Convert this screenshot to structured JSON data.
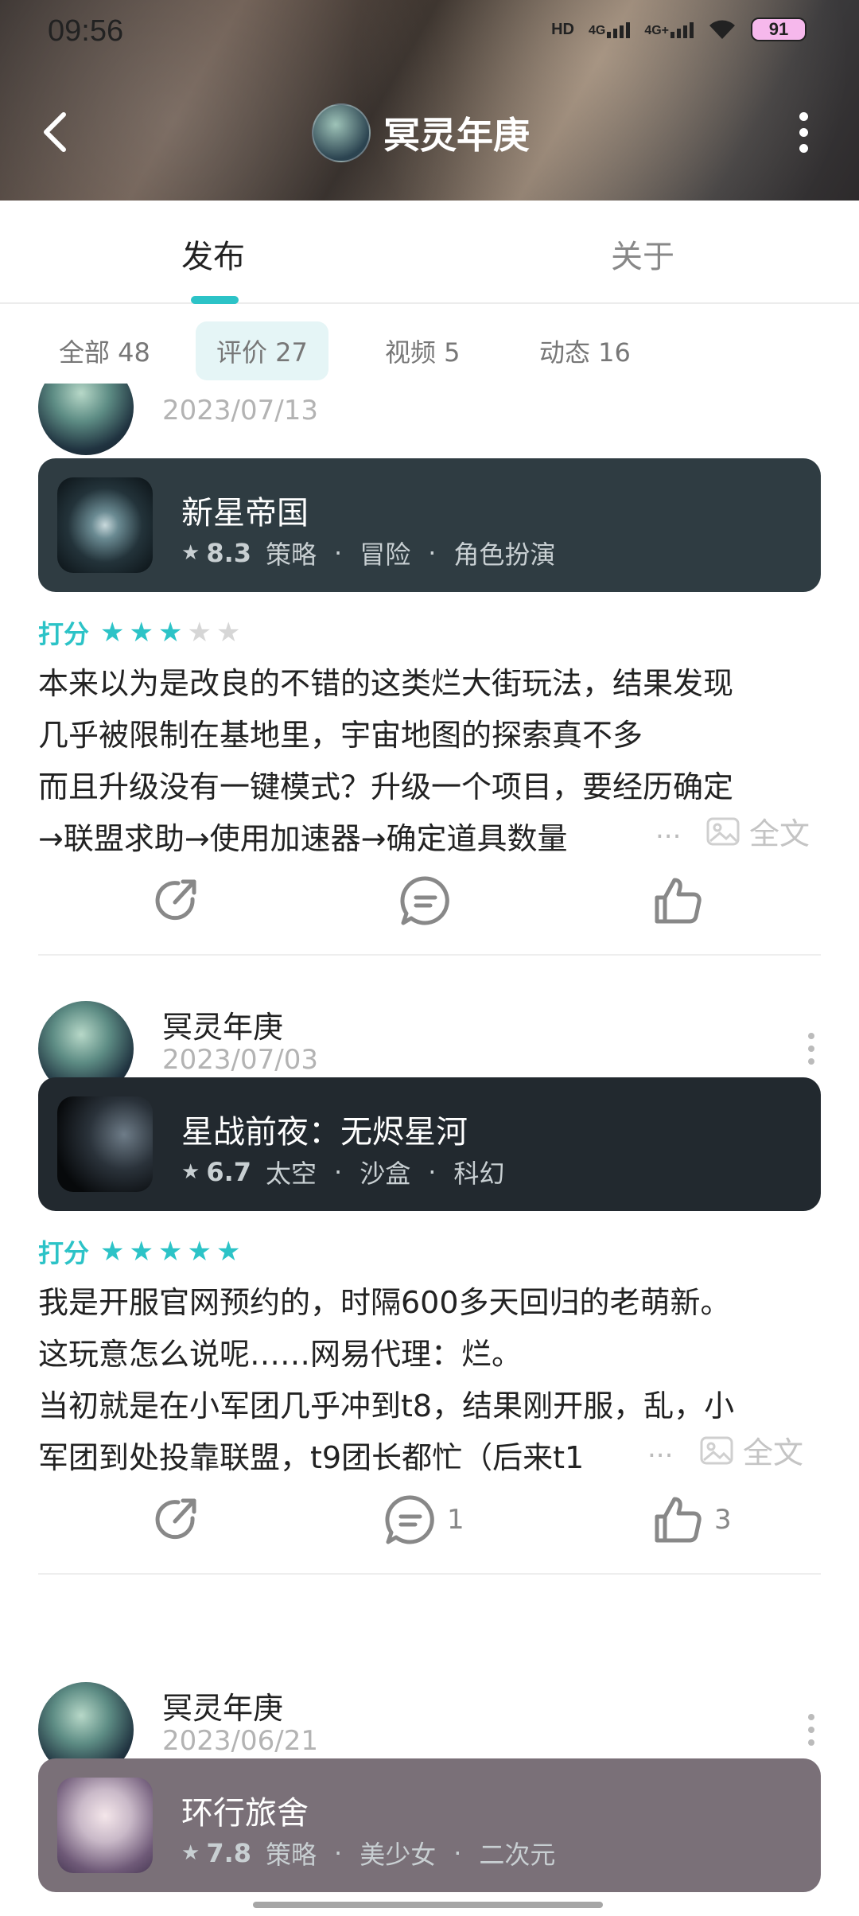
{
  "status_bar": {
    "time": "09:56",
    "battery": "91",
    "hd": "HD",
    "net1": "4G",
    "net2": "4G+"
  },
  "header": {
    "title": "冥灵年庚"
  },
  "tabs": [
    {
      "label": "发布"
    },
    {
      "label": "关于"
    }
  ],
  "filters": [
    {
      "label": "全部 48"
    },
    {
      "label": "评价 27"
    },
    {
      "label": "视频 5"
    },
    {
      "label": "动态 16"
    }
  ],
  "rating_label": "打分",
  "fulltext_label": "全文",
  "ellipsis": "...",
  "posts": [
    {
      "date": "2023/07/13",
      "game": {
        "name": "新星帝国",
        "score": "8.3",
        "tags": [
          "策略",
          "冒险",
          "角色扮演"
        ]
      },
      "stars": 3,
      "lines": [
        "本来以为是改良的不错的这类烂大街玩法，结果发现",
        "几乎被限制在基地里，宇宙地图的探索真不多",
        "而且升级没有一键模式？升级一个项目，要经历确定",
        "→联盟求助→使用加速器→确定道具数量"
      ],
      "comments": "",
      "likes": ""
    },
    {
      "author": "冥灵年庚",
      "date": "2023/07/03",
      "game": {
        "name": "星战前夜：无烬星河",
        "score": "6.7",
        "tags": [
          "太空",
          "沙盒",
          "科幻"
        ]
      },
      "stars": 5,
      "lines": [
        "我是开服官网预约的，时隔600多天回归的老萌新。",
        "这玩意怎么说呢……网易代理：烂。",
        "当初就是在小军团几乎冲到t8，结果刚开服，乱，小",
        "军团到处投靠联盟，t9团长都忙（后来t1"
      ],
      "comments": "1",
      "likes": "3"
    },
    {
      "author": "冥灵年庚",
      "date": "2023/06/21",
      "game": {
        "name": "环行旅舍",
        "score": "7.8",
        "tags": [
          "策略",
          "美少女",
          "二次元"
        ]
      }
    }
  ]
}
